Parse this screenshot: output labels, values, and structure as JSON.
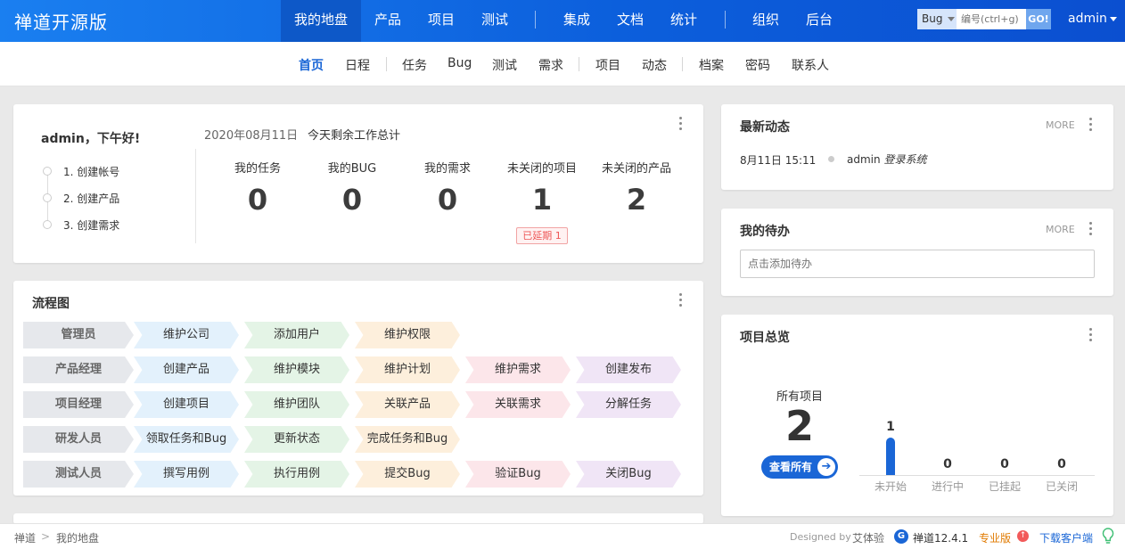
{
  "header": {
    "brand": "禅道开源版",
    "nav": [
      "我的地盘",
      "产品",
      "项目",
      "测试",
      "集成",
      "文档",
      "统计",
      "组织",
      "后台"
    ],
    "active_nav": "我的地盘",
    "search": {
      "type": "Bug",
      "placeholder": "编号(ctrl+g)",
      "go": "GO!"
    },
    "user": "admin"
  },
  "subnav": {
    "items": [
      "首页",
      "日程",
      "任务",
      "Bug",
      "测试",
      "需求",
      "项目",
      "动态",
      "档案",
      "密码",
      "联系人"
    ],
    "active": "首页"
  },
  "welcome": {
    "greeting": "admin，下午好!",
    "date": "2020年08月11日",
    "summary": "今天剩余工作总计",
    "steps": [
      "1. 创建帐号",
      "2. 创建产品",
      "3. 创建需求"
    ],
    "stats": [
      {
        "label": "我的任务",
        "value": "0"
      },
      {
        "label": "我的BUG",
        "value": "0"
      },
      {
        "label": "我的需求",
        "value": "0"
      },
      {
        "label": "未关闭的项目",
        "value": "1"
      },
      {
        "label": "未关闭的产品",
        "value": "2"
      }
    ],
    "delayed_badge": "已延期 1"
  },
  "flow": {
    "title": "流程图",
    "rows": [
      {
        "role": "管理员",
        "steps": [
          "维护公司",
          "添加用户",
          "维护权限"
        ]
      },
      {
        "role": "产品经理",
        "steps": [
          "创建产品",
          "维护模块",
          "维护计划",
          "维护需求",
          "创建发布"
        ]
      },
      {
        "role": "项目经理",
        "steps": [
          "创建项目",
          "维护团队",
          "关联产品",
          "关联需求",
          "分解任务"
        ]
      },
      {
        "role": "研发人员",
        "steps": [
          "领取任务和Bug",
          "更新状态",
          "完成任务和Bug"
        ]
      },
      {
        "role": "测试人员",
        "steps": [
          "撰写用例",
          "执行用例",
          "提交Bug",
          "验证Bug",
          "关闭Bug"
        ]
      }
    ]
  },
  "dynamic": {
    "title": "最新动态",
    "more": "MORE",
    "items": [
      {
        "time": "8月11日 15:11",
        "actor": "admin",
        "action": "登录系统"
      }
    ]
  },
  "todo": {
    "title": "我的待办",
    "more": "MORE",
    "placeholder": "点击添加待办"
  },
  "project_overview": {
    "title": "项目总览",
    "all_label": "所有项目",
    "all_count": "2",
    "view_all": "查看所有",
    "chart_data": {
      "type": "bar",
      "categories": [
        "未开始",
        "进行中",
        "已挂起",
        "已关闭"
      ],
      "values": [
        1,
        0,
        0,
        0
      ],
      "ylim": [
        0,
        1
      ],
      "color": "#1a66d6"
    }
  },
  "footer": {
    "breadcrumb": [
      "禅道",
      "我的地盘"
    ],
    "separator": ">",
    "designed_by": "Designed by",
    "designer": "艾体验",
    "version": "禅道12.4.1",
    "pro": "专业版",
    "download": "下载客户端"
  },
  "colors": {
    "primary": "#1a66d6",
    "header_start": "#1a7ff0",
    "header_end": "#0b4fd0",
    "delay_red": "#e55555"
  }
}
